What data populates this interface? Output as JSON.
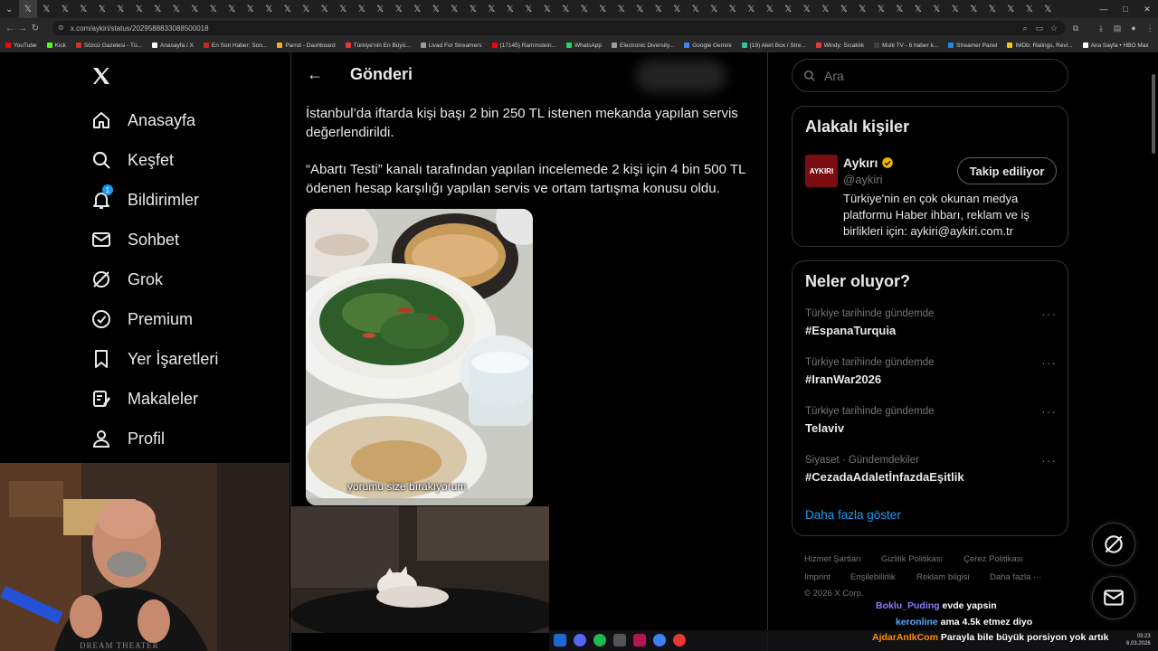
{
  "browser": {
    "url": "x.com/aykiri/status/2029588833088500018",
    "tab_glyph": "𝕏",
    "bookmarks": [
      {
        "label": "YouTube",
        "color": "#ff0000"
      },
      {
        "label": "Kick",
        "color": "#53fc18"
      },
      {
        "label": "Sözcü Gazetesi - Tü...",
        "color": "#d32f2f"
      },
      {
        "label": "Anasayfa / X",
        "color": "#ffffff"
      },
      {
        "label": "En Son Haber: Son...",
        "color": "#c62828"
      },
      {
        "label": "Parrot - Dashboard",
        "color": "#f9a825"
      },
      {
        "label": "Türkiye'nin En Büyü...",
        "color": "#e53935"
      },
      {
        "label": "Livad For Streamers",
        "color": "#9e9e9e"
      },
      {
        "label": "(17145) Rammstein...",
        "color": "#ff0000"
      },
      {
        "label": "WhatsApp",
        "color": "#25d366"
      },
      {
        "label": "Electronic Diversity...",
        "color": "#9e9e9e"
      },
      {
        "label": "Google Gemini",
        "color": "#4285f4"
      },
      {
        "label": "(19) Alert Box / Stre...",
        "color": "#31c3a2"
      },
      {
        "label": "Windy: Sıcaklık",
        "color": "#e53935"
      },
      {
        "label": "Multi TV - 6 haber k...",
        "color": "#424242"
      },
      {
        "label": "Streamer Panel",
        "color": "#1e88e5"
      },
      {
        "label": "IMDb: Ratings, Revi...",
        "color": "#f5c518"
      },
      {
        "label": "Ana Sayfa • HBO Max",
        "color": "#ffffff"
      }
    ],
    "bookmarks_more": "»",
    "all_bookmarks": "Tüm Yer İşaretleri"
  },
  "nav": {
    "items": [
      {
        "label": "Anasayfa",
        "icon": "home-icon"
      },
      {
        "label": "Keşfet",
        "icon": "search-icon"
      },
      {
        "label": "Bildirimler",
        "icon": "bell-icon",
        "badge": "1"
      },
      {
        "label": "Sohbet",
        "icon": "mail-icon"
      },
      {
        "label": "Grok",
        "icon": "grok-icon"
      },
      {
        "label": "Premium",
        "icon": "premium-icon"
      },
      {
        "label": "Yer İşaretleri",
        "icon": "bookmark-icon"
      },
      {
        "label": "Makaleler",
        "icon": "article-icon"
      },
      {
        "label": "Profil",
        "icon": "profile-icon"
      }
    ]
  },
  "post": {
    "header_title": "Gönderi",
    "paragraph1": "İstanbul’da iftarda kişi başı 2 bin 250 TL istenen mekanda yapılan servis değerlendirildi.",
    "paragraph2": "“Abartı Testi” kanalı tarafından yapılan incelemede 2 kişi için 4 bin 500 TL ödenen hesap karşılığı yapılan servis ve ortam tartışma konusu oldu.",
    "media_caption": "yorumu size bırakıyorum"
  },
  "sidebar": {
    "search_placeholder": "Ara",
    "relevant": {
      "title": "Alakalı kişiler",
      "name": "Aykırı",
      "handle": "@aykiri",
      "avatar_text": "AYKIRI",
      "bio": "Türkiye'nin en çok okunan medya platformu Haber ihbarı, reklam ve iş birlikleri için: aykiri@aykiri.com.tr",
      "follow_label": "Takip ediliyor"
    },
    "trends": {
      "title": "Neler oluyor?",
      "items": [
        {
          "context": "Türkiye tarihinde gündemde",
          "name": "#EspanaTurquia"
        },
        {
          "context": "Türkiye tarihinde gündemde",
          "name": "#IranWar2026"
        },
        {
          "context": "Türkiye tarihinde gündemde",
          "name": "Telaviv"
        },
        {
          "context": "Siyaset · Gündemdekiler",
          "name": "#CezadaAdaletİnfazdaEşitlik"
        }
      ],
      "more_dots": "···",
      "show_more": "Daha fazla göster"
    },
    "footer": [
      "Hizmet Şartları",
      "Gizlilik Politikası",
      "Çerez Politikası",
      "Imprint",
      "Erişilebilirlik",
      "Reklam bilgisi",
      "Daha fazla ···",
      "© 2026 X Corp."
    ]
  },
  "chat": [
    {
      "user": "Boklu_Puding",
      "user_color": "#8a7dff",
      "message": "evde yapsin"
    },
    {
      "user": "keronline",
      "user_color": "#5aa9ff",
      "message": "ama 4.5k etmez diyo"
    },
    {
      "user": "AjdarAnIkCom",
      "user_color": "#ff8c00",
      "message": "Parayla bile büyük porsiyon yok artık"
    }
  ],
  "webcam": {
    "shirt_text": "DREAM THEATER"
  },
  "clock": {
    "time": "03:23",
    "date": "6.03.2026"
  },
  "colors": {
    "accent": "#1d9bf0",
    "verified": "#e9b308",
    "muted": "#71767b"
  }
}
